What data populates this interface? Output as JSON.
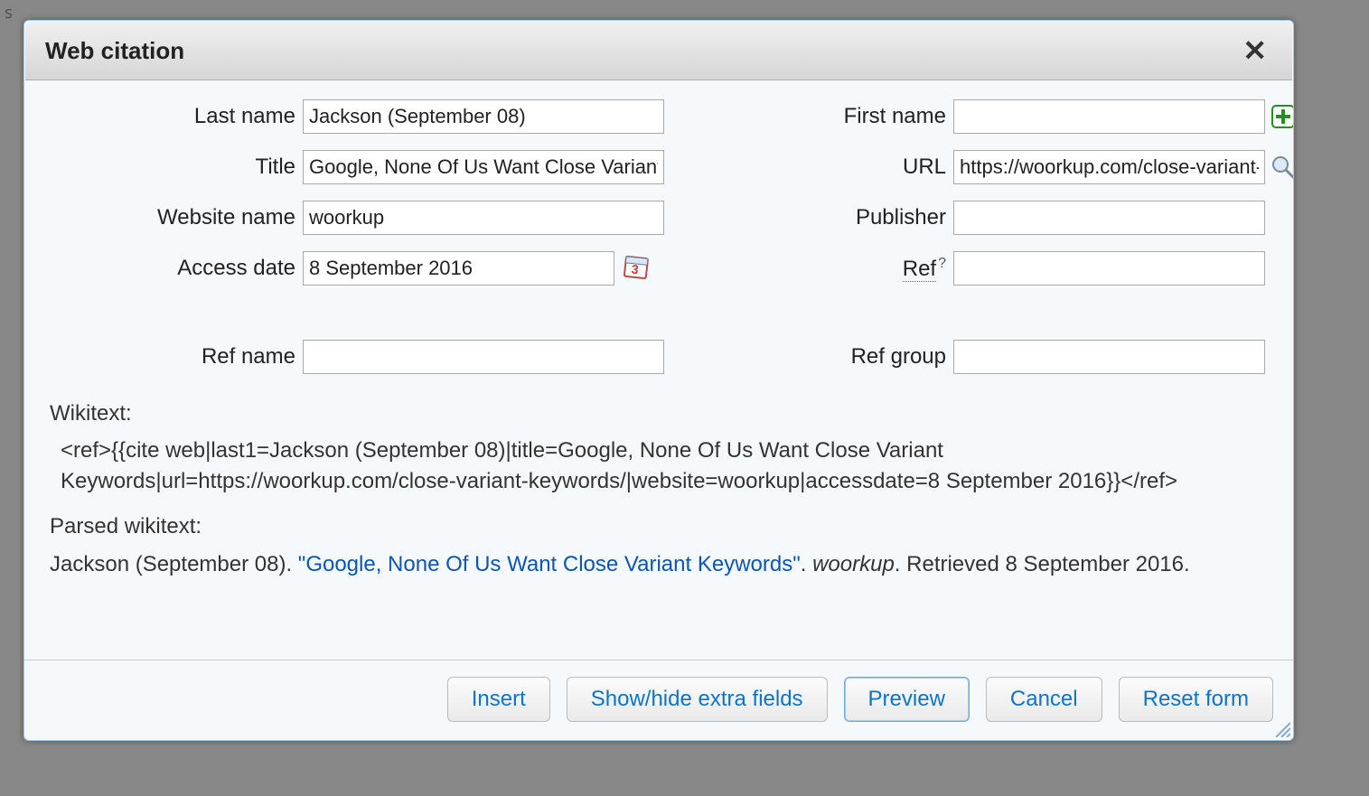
{
  "dialog": {
    "title": "Web citation"
  },
  "fields": {
    "last_name": {
      "label": "Last name",
      "value": "Jackson (September 08)"
    },
    "first_name": {
      "label": "First name",
      "value": ""
    },
    "title": {
      "label": "Title",
      "value": "Google, None Of Us Want Close Variant Keywords"
    },
    "url": {
      "label": "URL",
      "value": "https://woorkup.com/close-variant-keywords/"
    },
    "website_name": {
      "label": "Website name",
      "value": "woorkup"
    },
    "publisher": {
      "label": "Publisher",
      "value": ""
    },
    "access_date": {
      "label": "Access date",
      "value": "8 September 2016"
    },
    "ref_help": {
      "label": "Ref",
      "value": ""
    },
    "ref_name": {
      "label": "Ref name",
      "value": ""
    },
    "ref_group": {
      "label": "Ref group",
      "value": ""
    }
  },
  "wikitext": {
    "label": "Wikitext:",
    "content": "<ref>{{cite web|last1=Jackson (September 08)|title=Google, None Of Us Want Close Variant Keywords|url=https://woorkup.com/close-variant-keywords/|website=woorkup|accessdate=8 September 2016}}</ref>"
  },
  "parsed": {
    "label": "Parsed wikitext:",
    "author": "Jackson (September 08). ",
    "title_link": "\"Google, None Of Us Want Close Variant Keywords\"",
    "sep1": ". ",
    "website": "woorkup",
    "sep2": ". Retrieved ",
    "retrieved": "8 September 2016",
    "tail": "."
  },
  "buttons": {
    "insert": "Insert",
    "toggle": "Show/hide extra fields",
    "preview": "Preview",
    "cancel": "Cancel",
    "reset": "Reset form"
  }
}
